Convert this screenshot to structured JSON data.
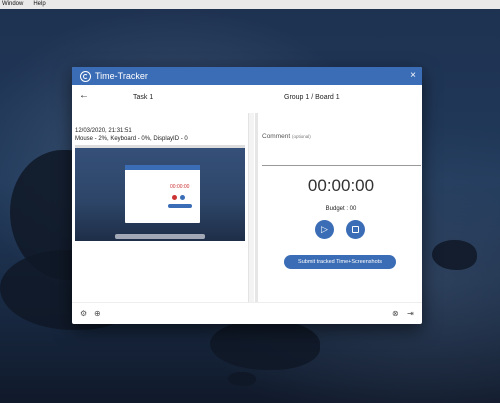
{
  "menubar": {
    "items": [
      "Window",
      "Help"
    ]
  },
  "window": {
    "title": "Time-Tracker",
    "close_label": "×"
  },
  "header": {
    "back_label": "←",
    "task_name": "Task 1",
    "group_board": "Group 1 / Board 1"
  },
  "screenshot": {
    "timestamp": "12/03/2020, 21:31:51",
    "activity": "Mouse - 2%, Keyboard - 0%, DisplayID - 0",
    "inner_timer": "00:00:00"
  },
  "comment": {
    "label": "Comment",
    "optional": "(optional)",
    "value": ""
  },
  "timer": {
    "display": "00:00:00",
    "budget": "Budget : 00"
  },
  "buttons": {
    "play_icon": "▷",
    "submit_label": "Submit tracked Time+Screenshots"
  },
  "footer": {
    "settings_icon": "⚙",
    "globe_icon": "⊕",
    "info_icon": "⊗",
    "logout_icon": "⇥"
  },
  "colors": {
    "accent": "#3b6db6"
  }
}
